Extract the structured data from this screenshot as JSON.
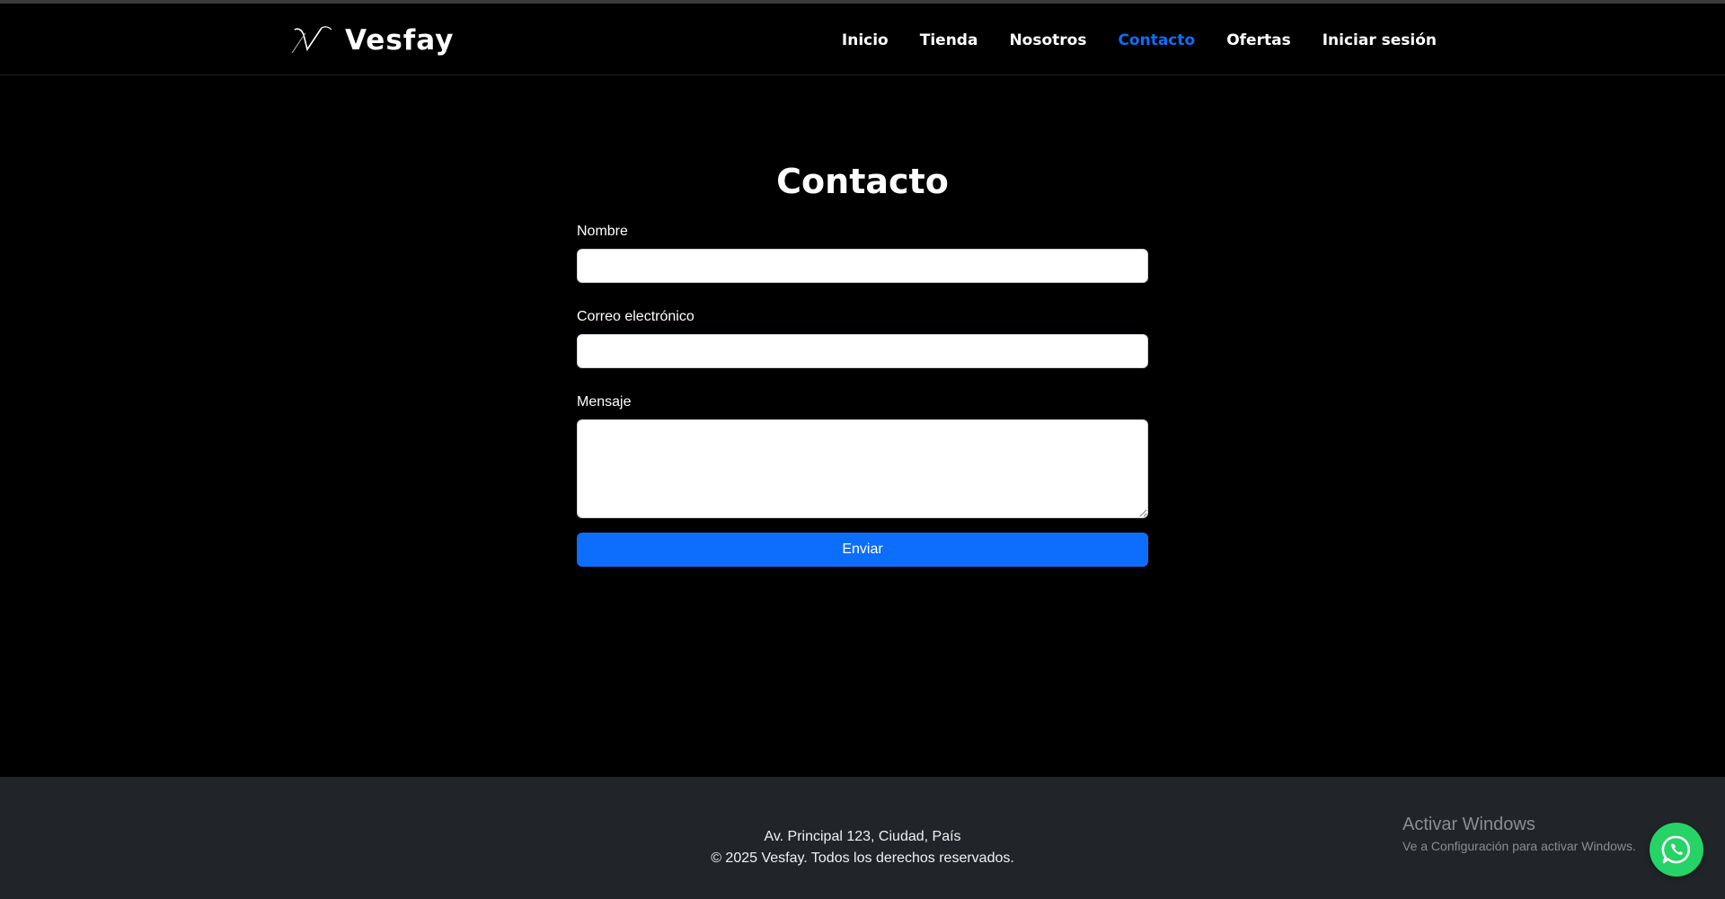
{
  "brand": {
    "name": "Vesfay",
    "logo": "v-logo-icon"
  },
  "nav": {
    "items": [
      {
        "label": "Inicio",
        "active": false
      },
      {
        "label": "Tienda",
        "active": false
      },
      {
        "label": "Nosotros",
        "active": false
      },
      {
        "label": "Contacto",
        "active": true
      },
      {
        "label": "Ofertas",
        "active": false
      },
      {
        "label": "Iniciar sesión",
        "active": false
      }
    ]
  },
  "contact": {
    "title": "Contacto",
    "name_label": "Nombre",
    "name_value": "",
    "email_label": "Correo electrónico",
    "email_value": "",
    "message_label": "Mensaje",
    "message_value": "",
    "submit_label": "Enviar"
  },
  "footer": {
    "address": "Av. Principal 123, Ciudad, País",
    "copyright": "© 2025 Vesfay. Todos los derechos reservados."
  },
  "windows_watermark": {
    "title": "Activar Windows",
    "subtitle": "Ve a Configuración para activar Windows."
  },
  "whatsapp": {
    "icon": "whatsapp-icon"
  },
  "colors": {
    "background": "#000000",
    "accent": "#0d6efd",
    "footer_bg": "#212529",
    "whatsapp": "#25d366"
  }
}
